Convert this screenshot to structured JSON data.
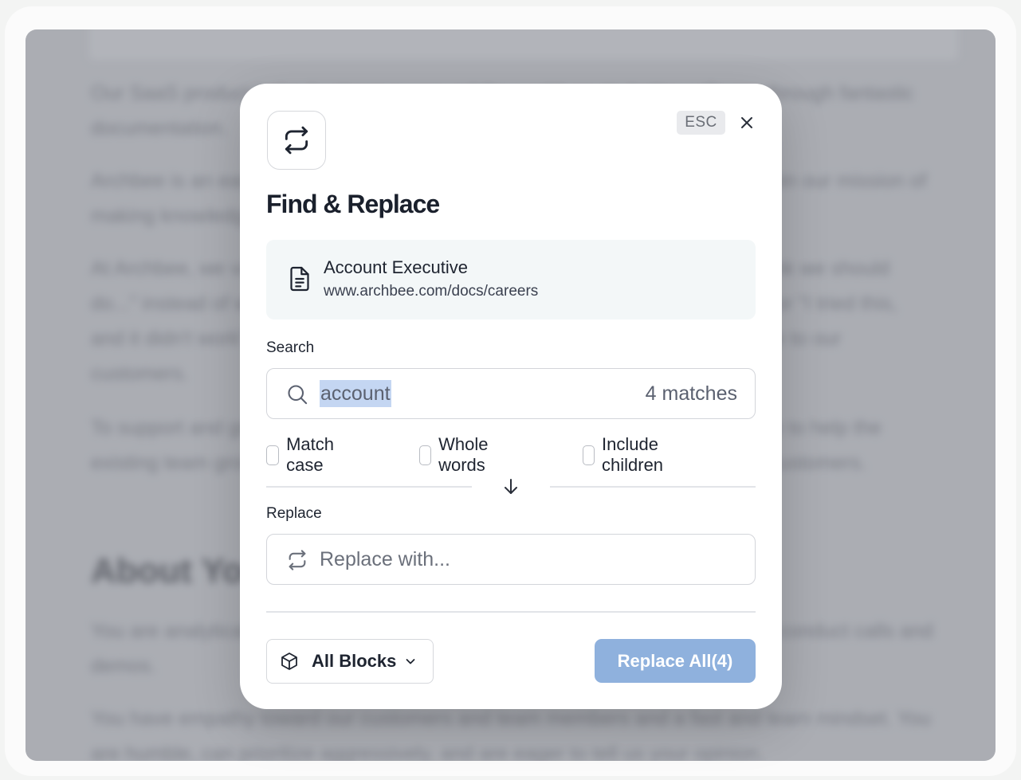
{
  "background_doc": {
    "paragraph_1": "Our SaaS product helps businesses around the world create better software through fantastic documentation.",
    "paragraph_2": "Archbee is an early-stage company and we're looking for amazing people to join our mission of making knowledge sharing easy for everyone in the world.",
    "paragraph_3": "At Archbee, we value ownership and initiative. We love when people say \"I think we should do...\" instead of waiting for instructions. If something works, \"Let's do it more\" or \"I tried this, and it didn't work\". We want every one of us to own their work and brings value to our customers.",
    "paragraph_4": "To support and grow our sales efforts, we are looking for an Account Executive to help the existing team grow and become a key driver in converting existing leads into customers.",
    "heading": "About You",
    "paragraph_5": "You are analytical and detail-oriented, and you know your product very well to conduct calls and demos.",
    "paragraph_6": "You have empathy toward our customers and team members and a fast and learn mindset. You are humble, can prioritize aggressively, and are eager to tell us your opinion."
  },
  "modal": {
    "esc_label": "ESC",
    "title": "Find & Replace",
    "document": {
      "title": "Account Executive",
      "url": "www.archbee.com/docs/careers"
    },
    "search": {
      "label": "Search",
      "value": "account",
      "match_count": "4 matches"
    },
    "options": {
      "match_case": "Match case",
      "whole_words": "Whole words",
      "include_children": "Include children"
    },
    "replace": {
      "label": "Replace",
      "placeholder": "Replace with..."
    },
    "scope_select": "All Blocks",
    "replace_all_button": "Replace All(4)"
  },
  "colors": {
    "primary_button": "#8fb1dd",
    "selection_highlight": "#c4d6f2",
    "doc_card_bg": "#f3f7f8"
  }
}
